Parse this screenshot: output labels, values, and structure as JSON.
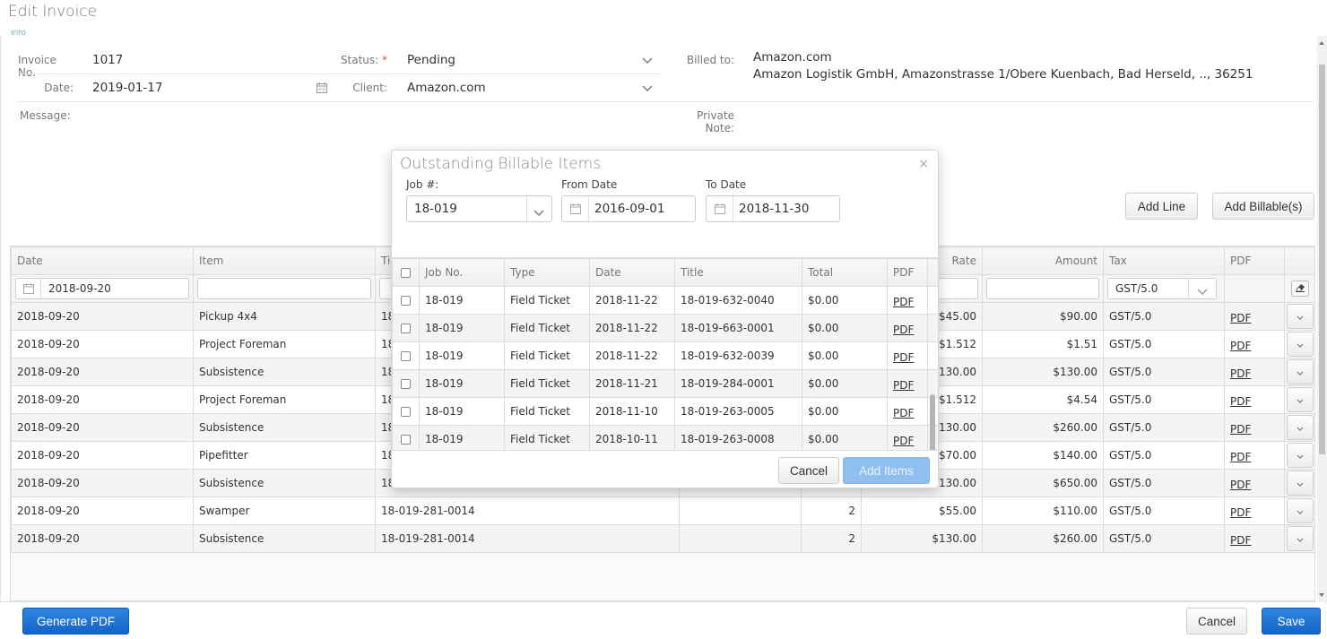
{
  "page": {
    "title": "Edit Invoice",
    "info_tab": "Info"
  },
  "form": {
    "invoice_no_label": "Invoice No.",
    "invoice_no": "1017",
    "date_label": "Date:",
    "date": "2019-01-17",
    "status_label": "Status:",
    "status_required": "*",
    "status": "Pending",
    "client_label": "Client:",
    "client": "Amazon.com",
    "billed_to_label": "Billed to:",
    "billed_to_name": "Amazon.com",
    "billed_to_address": "Amazon Logistik GmbH, Amazonstrasse 1/Obere Kuenbach, Bad Herseld, .., 36251",
    "message_label": "Message:",
    "private_note_label": "Private Note:"
  },
  "actions": {
    "add_line": "Add Line",
    "add_billables": "Add Billable(s)"
  },
  "main_table": {
    "columns": [
      "Date",
      "Item",
      "Tic",
      "",
      "",
      "Rate",
      "Amount",
      "Tax",
      "PDF",
      ""
    ],
    "filter": {
      "date": "2018-09-20",
      "item": "",
      "rate": "",
      "amount": "",
      "tax": "GST/5.0"
    },
    "rows": [
      {
        "date": "2018-09-20",
        "item": "Pickup 4x4",
        "ticket": "18",
        "desc": "",
        "qty": "",
        "rate": "$45.00",
        "amount": "$90.00",
        "tax": "GST/5.0",
        "pdf": "PDF"
      },
      {
        "date": "2018-09-20",
        "item": "Project Foreman",
        "ticket": "18",
        "desc": "",
        "qty": "",
        "rate": "$1.512",
        "amount": "$1.51",
        "tax": "GST/5.0",
        "pdf": "PDF"
      },
      {
        "date": "2018-09-20",
        "item": "Subsistence",
        "ticket": "18",
        "desc": "",
        "qty": "",
        "rate": "$130.00",
        "amount": "$130.00",
        "tax": "GST/5.0",
        "pdf": "PDF"
      },
      {
        "date": "2018-09-20",
        "item": "Project Foreman",
        "ticket": "18",
        "desc": "",
        "qty": "",
        "rate": "$1.512",
        "amount": "$4.54",
        "tax": "GST/5.0",
        "pdf": "PDF"
      },
      {
        "date": "2018-09-20",
        "item": "Subsistence",
        "ticket": "18",
        "desc": "",
        "qty": "",
        "rate": "$130.00",
        "amount": "$260.00",
        "tax": "GST/5.0",
        "pdf": "PDF"
      },
      {
        "date": "2018-09-20",
        "item": "Pipefitter",
        "ticket": "18",
        "desc": "",
        "qty": "",
        "rate": "$70.00",
        "amount": "$140.00",
        "tax": "GST/5.0",
        "pdf": "PDF"
      },
      {
        "date": "2018-09-20",
        "item": "Subsistence",
        "ticket": "18",
        "desc": "",
        "qty": "",
        "rate": "$130.00",
        "amount": "$650.00",
        "tax": "GST/5.0",
        "pdf": "PDF"
      },
      {
        "date": "2018-09-20",
        "item": "Swamper",
        "ticket": "18-019-281-0014",
        "desc": "",
        "qty": "2",
        "rate": "$55.00",
        "amount": "$110.00",
        "tax": "GST/5.0",
        "pdf": "PDF"
      },
      {
        "date": "2018-09-20",
        "item": "Subsistence",
        "ticket": "18-019-281-0014",
        "desc": "",
        "qty": "2",
        "rate": "$130.00",
        "amount": "$260.00",
        "tax": "GST/5.0",
        "pdf": "PDF"
      }
    ]
  },
  "modal": {
    "title": "Outstanding Billable Items",
    "close": "×",
    "job_label": "Job #:",
    "job_value": "18-019",
    "from_label": "From Date",
    "from_value": "2016-09-01",
    "to_label": "To Date",
    "to_value": "2018-11-30",
    "columns": [
      "",
      "Job No.",
      "Type",
      "Date",
      "Title",
      "Total",
      "PDF"
    ],
    "rows": [
      {
        "job": "18-019",
        "type": "Field Ticket",
        "date": "2018-11-22",
        "title": "18-019-632-0040",
        "total": "$0.00",
        "pdf": "PDF"
      },
      {
        "job": "18-019",
        "type": "Field Ticket",
        "date": "2018-11-22",
        "title": "18-019-663-0001",
        "total": "$0.00",
        "pdf": "PDF"
      },
      {
        "job": "18-019",
        "type": "Field Ticket",
        "date": "2018-11-22",
        "title": "18-019-632-0039",
        "total": "$0.00",
        "pdf": "PDF"
      },
      {
        "job": "18-019",
        "type": "Field Ticket",
        "date": "2018-11-21",
        "title": "18-019-284-0001",
        "total": "$0.00",
        "pdf": "PDF"
      },
      {
        "job": "18-019",
        "type": "Field Ticket",
        "date": "2018-11-10",
        "title": "18-019-263-0005",
        "total": "$0.00",
        "pdf": "PDF"
      },
      {
        "job": "18-019",
        "type": "Field Ticket",
        "date": "2018-10-11",
        "title": "18-019-263-0008",
        "total": "$0.00",
        "pdf": "PDF"
      }
    ],
    "cancel": "Cancel",
    "add_items": "Add Items"
  },
  "footer": {
    "generate_pdf": "Generate PDF",
    "cancel": "Cancel",
    "save": "Save"
  },
  "colors": {
    "primary": "#1a6fd4",
    "add_items_disabled": "#8fbfee",
    "required": "#d9534f"
  }
}
